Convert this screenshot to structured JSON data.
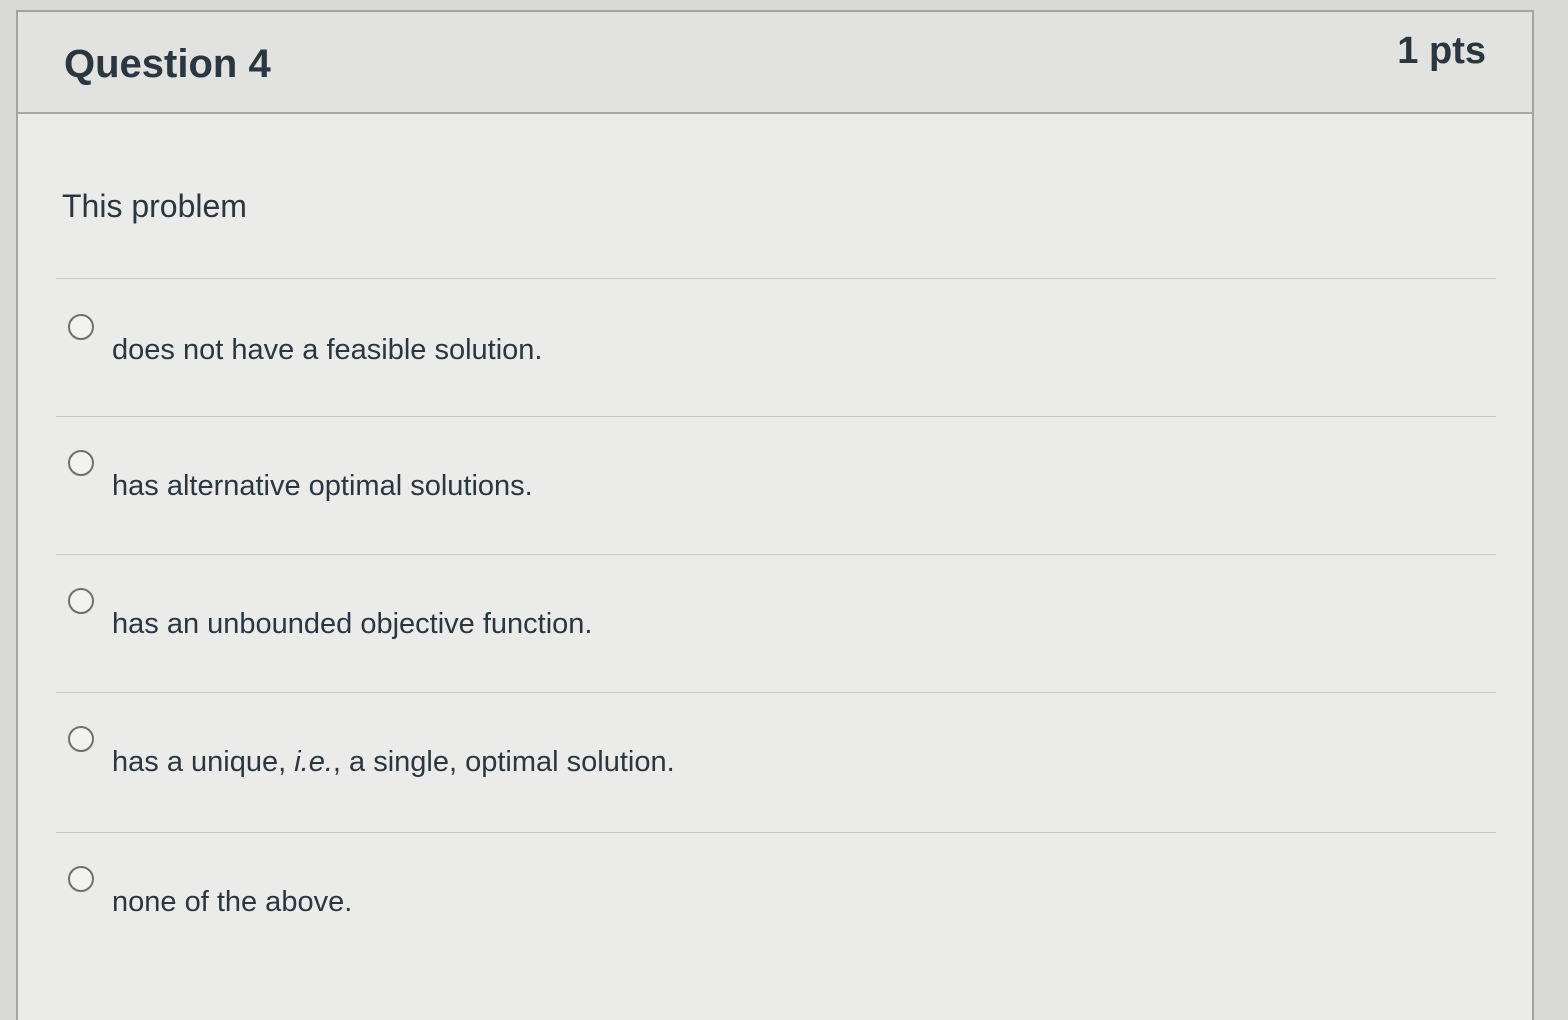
{
  "question": {
    "title": "Question 4",
    "points": "1 pts",
    "stem": "This problem"
  },
  "answers": [
    {
      "label": "does not have a feasible solution.",
      "selected": false
    },
    {
      "label": "has alternative optimal solutions.",
      "selected": false
    },
    {
      "label": "has an unbounded objective function.",
      "selected": false
    },
    {
      "label_before": "has a unique, ",
      "label_italic": "i.e.",
      "label_after": ", a single, optimal solution.",
      "selected": false
    },
    {
      "label": "none of the above.",
      "selected": false
    }
  ]
}
